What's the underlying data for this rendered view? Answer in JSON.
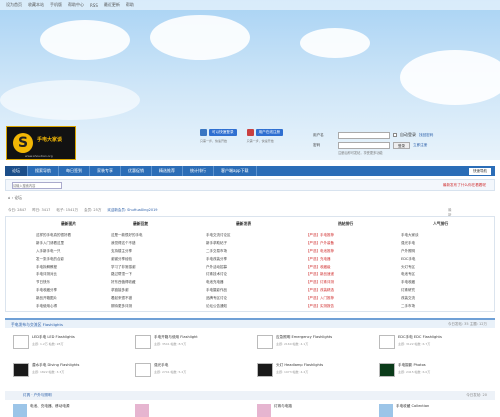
{
  "topbar": {
    "links": [
      "设为首页",
      "收藏本站",
      "手机版",
      "帮助中心",
      "RSS",
      "最近更新",
      "帮助"
    ]
  },
  "logo": {
    "letter": "S",
    "name": "手电大家谈",
    "url": "www.shoudian.org"
  },
  "header_buttons": [
    {
      "label": "可以快速登录",
      "sub": "只需一步，快速开始"
    },
    {
      "label": "用户在线注册",
      "sub": "只需一步，快速开始"
    }
  ],
  "login": {
    "user_label": "用户名",
    "pass_label": "密码",
    "remember": "自动登录",
    "forgot": "找回密码",
    "submit": "登录",
    "register": "立即注册",
    "help": "注册后即可发帖，享受更多功能"
  },
  "nav": {
    "items": [
      "论坛",
      "搜索导航",
      "每日签到",
      "家装专享",
      "优惠促销",
      "精选推荐",
      "统计排行",
      "客户端app下载"
    ],
    "select": "快速导航"
  },
  "search": {
    "placeholder": "请输入搜索内容",
    "right": "最新发布了什么你在看着呢"
  },
  "breadcrumb": "论坛",
  "stats": [
    "今日: 2847",
    "昨日: 3417",
    "帖子: 1541万",
    "会员: 25万",
    "欢迎新会员: ShuHuaXing2019"
  ],
  "stats_right": "最新回复",
  "columns": [
    {
      "head": "最新图片",
      "items": [
        "这样的手电真的很好看",
        "新手入门请看这里",
        "入手新手电一只",
        "发一张手电的合影",
        "手电拆解教程",
        "手电评测对比",
        "节日快乐",
        "手电收藏分享",
        "新品开箱图片",
        "手电使用心得",
        "夜景拍摄"
      ]
    },
    {
      "head": "最新回复",
      "items": [
        "这是一款很好的手电",
        "我觉得这个不错",
        "支持楼主分享",
        "谢谢分享经验",
        "学习了非常感谢",
        "路过帮顶一下",
        "好东西值得收藏",
        "求链接多谢",
        "看起来很不错",
        "期待更多评测",
        "已经入手了"
      ]
    },
    {
      "head": "最新发表",
      "items": [
        "手电交流讨论区",
        "新手求助帖子",
        "二手交易市场",
        "手电改装分享",
        "户外活动招募",
        "灯珠技术讨论",
        "电池充电器",
        "手电摄影作品",
        "品牌专区讨论",
        "论坛公告通知",
        "意见建议反馈"
      ]
    },
    {
      "head": "热帖排行",
      "items": [
        "【严选】手电推荐",
        "【严选】户外装备",
        "【严选】电池推荐",
        "【严选】充电器",
        "【严选】收藏级",
        "【严选】新品速递",
        "【严选】灯珠评测",
        "【严选】改装精选",
        "【严选】入门推荐",
        "【严选】实测报告",
        "【严选】精华合集"
      ]
    },
    {
      "head": "人气排行",
      "items": [
        "手电大家谈",
        "强光手电",
        "户外照明",
        "EDC手电",
        "头灯专区",
        "电池专区",
        "手电收藏",
        "灯珠研究",
        "改装交流",
        "二手市场",
        "摄影分享"
      ]
    }
  ],
  "section1": {
    "title": "手电发布与交流区 Flashlights",
    "right": "今日发帖: 35  主题: 12万"
  },
  "forums": [
    [
      {
        "t": "LED手电 LED Flashlights",
        "m": "主题: 1.2万  帖数: 28万"
      },
      {
        "t": "手电开箱与使用 Flashlight",
        "m": "主题: 3541  帖数: 8.5万"
      },
      {
        "t": "应急照明 Emergency Flashlights",
        "m": "主题: 2160  帖数: 4.1万"
      },
      {
        "t": "EDC手电 EDC Flashlights",
        "m": "主题: 3122  帖数: 6.7万"
      }
    ],
    [
      {
        "t": "潜水手电 Diving Flashlights",
        "m": "主题: 1822  帖数: 3.3万"
      },
      {
        "t": "强光手电",
        "m": "主题: 2741  帖数: 5.2万"
      },
      {
        "t": "头灯 Headlamp Flashlights",
        "m": "主题: 1973  帖数: 4.4万"
      },
      {
        "t": "手电摄影 Photos",
        "m": "主题: 2415  帖数: 6.0万"
      }
    ]
  ],
  "section2": {
    "title": "灯具 · 户外与照明",
    "right": "今日发帖: 20"
  },
  "bottom": [
    {
      "t": "电池、充电器、移动电源"
    },
    {
      "t": ""
    },
    {
      "t": "灯珠与电路"
    },
    {
      "t": "手电收藏 Collection"
    }
  ]
}
